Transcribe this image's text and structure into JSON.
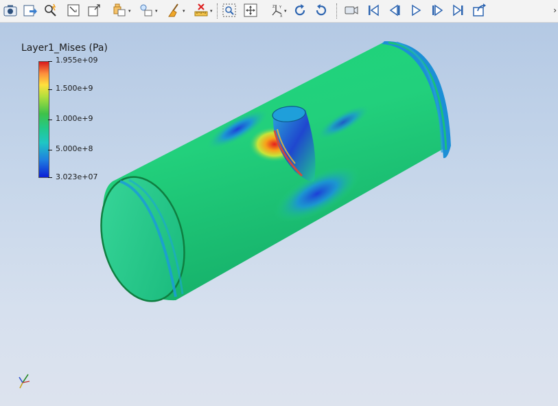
{
  "toolbar": {
    "buttons": [
      {
        "name": "camera-capture-icon"
      },
      {
        "name": "save-state-icon"
      },
      {
        "name": "find-data-icon"
      },
      {
        "name": "select-points-icon"
      },
      {
        "name": "select-cells-icon"
      },
      {
        "name": "extract-selection-icon"
      },
      {
        "name": "light-icon"
      },
      {
        "name": "clear-selection-brush-icon"
      },
      {
        "name": "measure-ruler-icon"
      },
      {
        "name": "zoom-to-box-icon"
      },
      {
        "name": "zoom-to-data-icon"
      },
      {
        "name": "axes-orientation-icon"
      },
      {
        "name": "rotate-ccw-icon"
      },
      {
        "name": "rotate-cw-icon"
      },
      {
        "name": "video-camera-icon"
      },
      {
        "name": "first-frame-icon"
      },
      {
        "name": "previous-frame-icon"
      },
      {
        "name": "play-icon"
      },
      {
        "name": "next-frame-icon"
      },
      {
        "name": "last-frame-icon"
      },
      {
        "name": "loop-icon"
      }
    ],
    "more_label": "›"
  },
  "legend": {
    "title": "Layer1_Mises (Pa)",
    "ticks": [
      "1.955e+09",
      "1.500e+9",
      "1.000e+9",
      "5.000e+8",
      "3.023e+07"
    ],
    "colors": {
      "max": "#d7191c",
      "mid": "#3ec24a",
      "min": "#0c1fd6"
    }
  },
  "scene": {
    "object": "pipe-with-branch",
    "main_color": "#1fcf78",
    "inner_color": "#2ccf92"
  }
}
